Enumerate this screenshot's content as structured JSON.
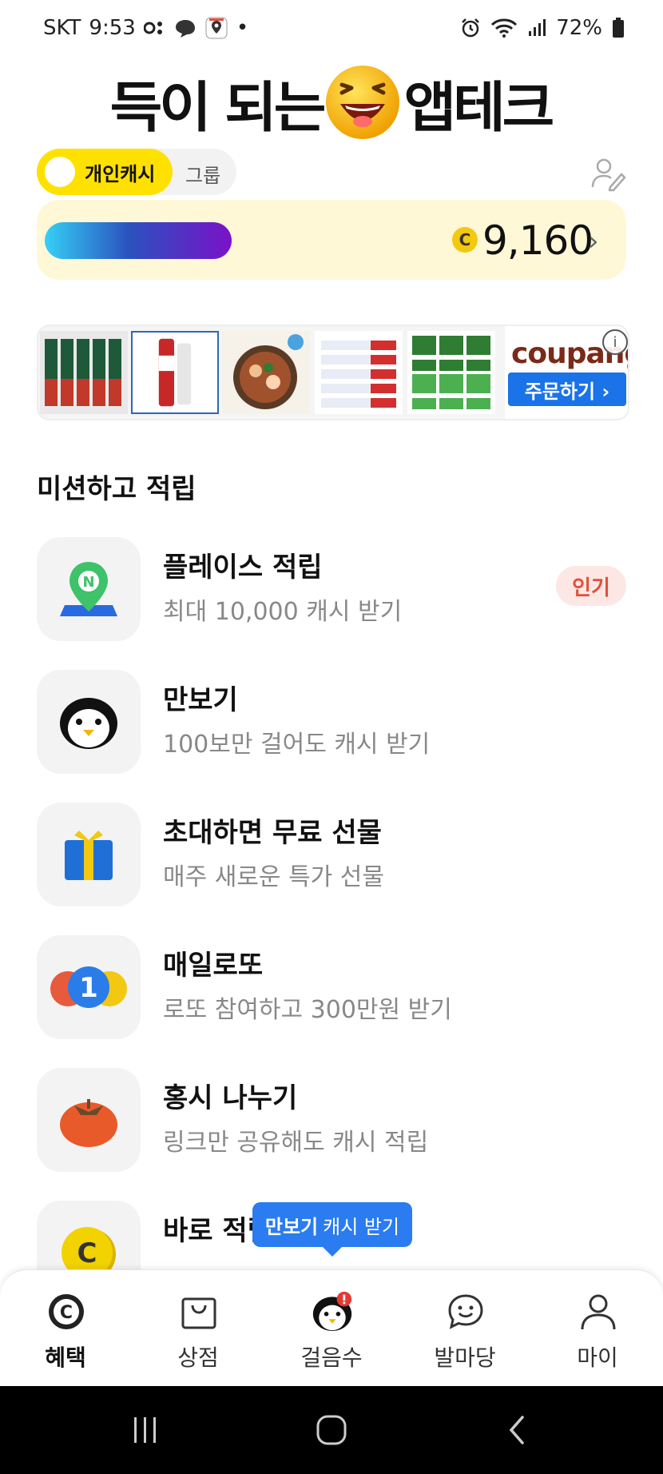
{
  "status_bar": {
    "carrier": "SKT",
    "time": "9:53",
    "battery": "72%",
    "dot": "•"
  },
  "banner": {
    "left_text": "득이 되는",
    "right_text": "앱테크"
  },
  "toggle": {
    "active_label": "개인캐시",
    "inactive_label": "그룹"
  },
  "points": {
    "coin_symbol": "C",
    "value": "9,160",
    "chevron": "›"
  },
  "ad": {
    "brand": "coupang",
    "cta": "주문하기 ›",
    "info": "i"
  },
  "missions": {
    "section_title": "미션하고 적립",
    "items": [
      {
        "title": "플레이스 적립",
        "desc": "최대 10,000 캐시 받기",
        "badge": "인기",
        "icon": "map-pin-icon"
      },
      {
        "title": "만보기",
        "desc": "100보만 걸어도 캐시 받기",
        "icon": "penguin-icon"
      },
      {
        "title": "초대하면 무료 선물",
        "desc": "매주 새로운 특가 선물",
        "icon": "gift-icon"
      },
      {
        "title": "매일로또",
        "desc": "로또 참여하고 300만원 받기",
        "icon": "lotto-ball-icon"
      },
      {
        "title": "홍시 나누기",
        "desc": "링크만 공유해도 캐시 적립",
        "icon": "persimmon-icon"
      },
      {
        "title": "바로 적립",
        "icon": "coin-icon"
      }
    ]
  },
  "tooltip": {
    "bold": "만보기",
    "rest": "캐시 받기"
  },
  "bottom_nav": {
    "items": [
      {
        "label": "혜택",
        "icon": "benefit-coin-icon",
        "active": true
      },
      {
        "label": "상점",
        "icon": "shopping-bag-icon"
      },
      {
        "label": "걸음수",
        "icon": "penguin-icon"
      },
      {
        "label": "발마당",
        "icon": "chat-smile-icon"
      },
      {
        "label": "마이",
        "icon": "person-icon"
      }
    ]
  },
  "colors": {
    "accent_yellow": "#ffe100",
    "card_bg": "#fff8d6",
    "popular_badge": "#e0503c",
    "tooltip_blue": "#2a7cf0",
    "coupang_blue": "#1a73e8"
  }
}
